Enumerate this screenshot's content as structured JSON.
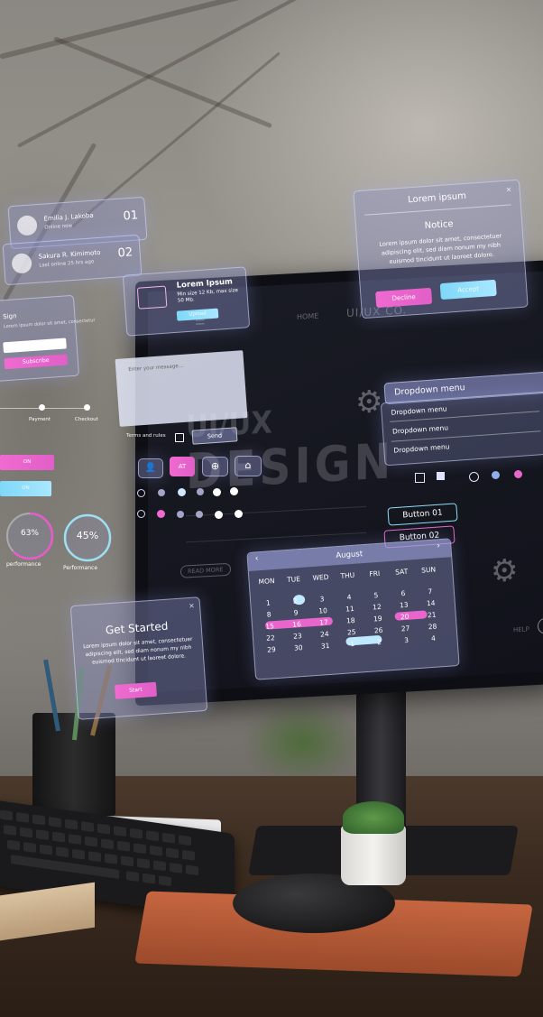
{
  "contacts": [
    {
      "name": "Emilia J. Lakoba",
      "sub": "Online now",
      "num": "01"
    },
    {
      "name": "Sakura R. Kimimoto",
      "sub": "Last online 25 hrs ago",
      "num": "02"
    }
  ],
  "left_form": {
    "title": "Sign",
    "sub": "Lorem ipsum dolor sit amet, consectetur",
    "button": "Subscribe"
  },
  "upload": {
    "title": "Lorem Ipsum",
    "desc": "Min size 12 Kb, max size 50 Mb.",
    "button": "Upload"
  },
  "notice": {
    "header": "Lorem ipsum",
    "title": "Notice",
    "body": "Lorem ipsum dolor sit amet, consectetuer adipiscing elit, sed diam nonum my nibh euismod tincidunt ut laoreet dolore.",
    "decline": "Decline",
    "accept": "Accept"
  },
  "message": {
    "placeholder": "Enter your message...",
    "terms": "Terms and rules",
    "send": "Send"
  },
  "stepper": {
    "labels": [
      "",
      "Payment",
      "Checkout"
    ]
  },
  "left_buttons": [
    "ON",
    "ON"
  ],
  "icon_buttons": [
    "user-icon",
    "at-icon",
    "plus-icon",
    "home-icon"
  ],
  "icon_button_at": "AT",
  "gauges": [
    {
      "value": "63%",
      "label": "performance",
      "color": "#e85bcc"
    },
    {
      "value": "45%",
      "label": "Performance",
      "color": "#9fdff4"
    }
  ],
  "get_started": {
    "title": "Get Started",
    "body": "Lorem ipsum dolor sit amet, consectetuer adipiscing elit, sed diam nonum my nibh euismod tincidunt ut laoreet dolore.",
    "button": "Start"
  },
  "dropdown": {
    "header": "Dropdown menu",
    "items": [
      "Dropdown menu",
      "Dropdown menu",
      "Dropdown menu"
    ]
  },
  "buttons_right": {
    "b1": "Button 01",
    "b2": "Button 02"
  },
  "calendar": {
    "month": "August",
    "days": [
      "MON",
      "TUE",
      "WED",
      "THU",
      "FRI",
      "SAT",
      "SUN"
    ],
    "rows": [
      [
        "1",
        "2",
        "3",
        "4",
        "5",
        "6",
        "7"
      ],
      [
        "8",
        "9",
        "10",
        "11",
        "12",
        "13",
        "14"
      ],
      [
        "15",
        "16",
        "17",
        "18",
        "19",
        "20",
        "21"
      ],
      [
        "22",
        "23",
        "24",
        "25",
        "26",
        "27",
        "28"
      ],
      [
        "29",
        "30",
        "31",
        "1",
        "2",
        "3",
        "4"
      ]
    ]
  },
  "screen": {
    "brand": "UI/UX CO.",
    "word1": "UI/UX",
    "word2": "DESIGN",
    "read_more": "READ MORE",
    "help": "HELP",
    "nav_active": "HOME"
  },
  "colors": {
    "accent_pink": "#e865cc",
    "accent_cyan": "#8fdcf7",
    "glass": "#8c91c8"
  }
}
